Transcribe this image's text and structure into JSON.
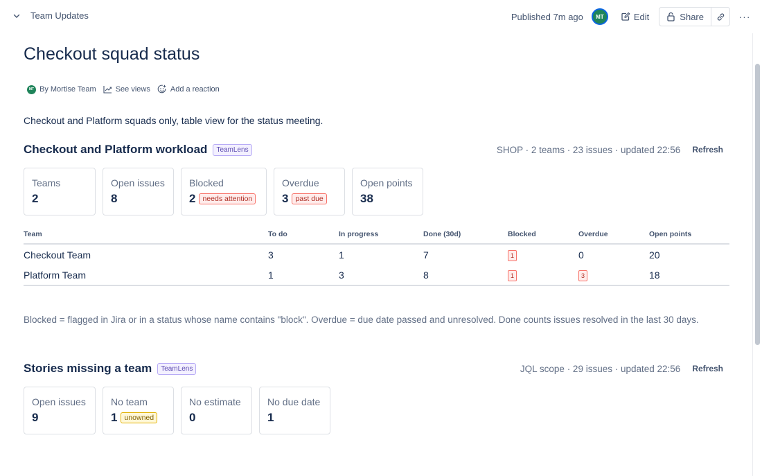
{
  "topbar": {
    "breadcrumb": "Team Updates",
    "published": "Published 7m ago",
    "avatar_initials": "MT",
    "edit_label": "Edit",
    "share_label": "Share",
    "more_label": "···"
  },
  "page": {
    "title": "Checkout squad status",
    "byline": {
      "avatar_initials": "MT",
      "author": "By Mortise Team",
      "views": "See views",
      "reaction": "Add a reaction"
    },
    "intro": "Checkout and Platform squads only, table view for the status meeting."
  },
  "workload": {
    "title": "Checkout and Platform workload",
    "lozenge": "TeamLens",
    "meta": "SHOP · 2 teams · 23 issues · updated 22:56",
    "refresh": "Refresh",
    "cards": [
      {
        "label": "Teams",
        "value": "2"
      },
      {
        "label": "Open issues",
        "value": "8"
      },
      {
        "label": "Blocked",
        "value": "2",
        "tag": "needs attention"
      },
      {
        "label": "Overdue",
        "value": "3",
        "tag": "past due"
      },
      {
        "label": "Open points",
        "value": "38"
      }
    ],
    "table": {
      "headers": [
        "Team",
        "To do",
        "In progress",
        "Done (30d)",
        "Blocked",
        "Overdue",
        "Open points"
      ],
      "rows": [
        {
          "team": "Checkout Team",
          "todo": "3",
          "in_progress": "1",
          "done": "7",
          "blocked": "1",
          "overdue": "0",
          "open_points": "20"
        },
        {
          "team": "Platform Team",
          "todo": "1",
          "in_progress": "3",
          "done": "8",
          "blocked": "1",
          "overdue": "3",
          "open_points": "18"
        }
      ]
    },
    "note": "Blocked = flagged in Jira or in a status whose name contains \"block\". Overdue = due date passed and unresolved. Done counts issues resolved in the last 30 days."
  },
  "missing": {
    "title": "Stories missing a team",
    "lozenge": "TeamLens",
    "meta": "JQL scope · 29 issues · updated 22:56",
    "refresh": "Refresh",
    "cards": [
      {
        "label": "Open issues",
        "value": "9"
      },
      {
        "label": "No team",
        "value": "1",
        "tag": "unowned"
      },
      {
        "label": "No estimate",
        "value": "0"
      },
      {
        "label": "No due date",
        "value": "1"
      }
    ]
  },
  "colors": {
    "accent_green": "#1f845a",
    "lozenge_purple": "#5e4db2",
    "danger_red": "#ae2e24",
    "warning_yellow": "#7f5f01"
  },
  "icons": [
    "chevron-down-icon",
    "edit-icon",
    "lock-icon",
    "link-icon",
    "more-icon",
    "chart-icon",
    "emoji-add-icon"
  ]
}
